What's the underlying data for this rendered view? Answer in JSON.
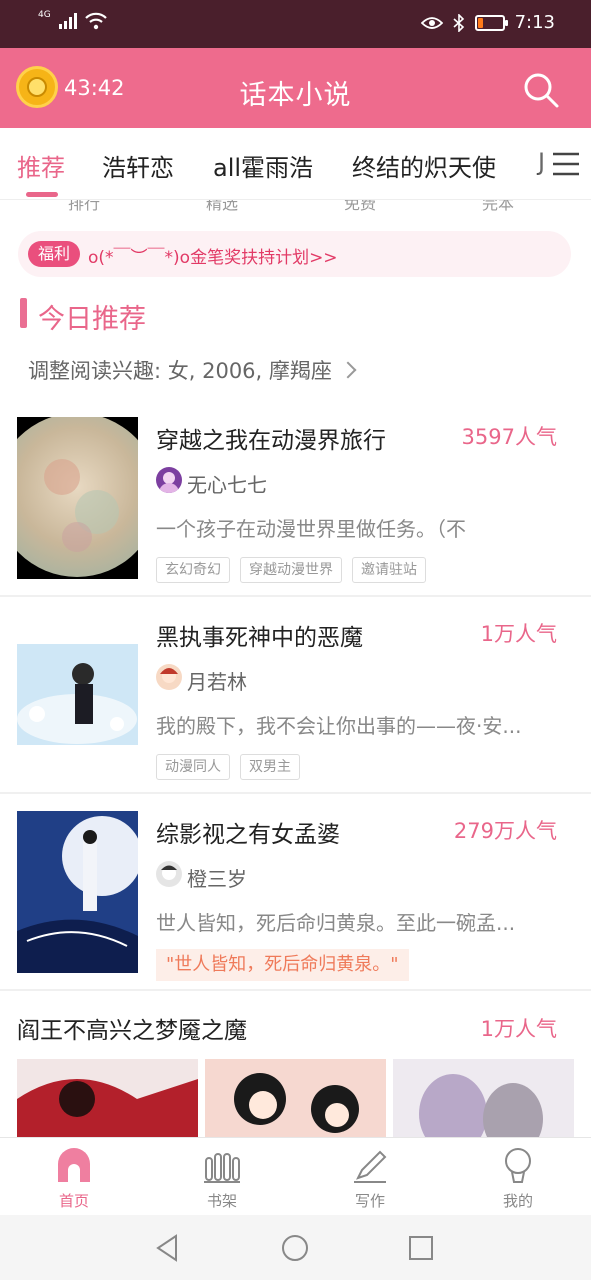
{
  "status_bar": {
    "network": "4G",
    "time": "7:13",
    "battery_level": 0.2
  },
  "header": {
    "timer": "43:42",
    "title": "话本小说"
  },
  "tabs": [
    {
      "label": "推荐",
      "active": true
    },
    {
      "label": "浩轩恋",
      "active": false
    },
    {
      "label": "all霍雨浩",
      "active": false
    },
    {
      "label": "终结的炽天使",
      "active": false
    },
    {
      "label": "J",
      "active": false
    }
  ],
  "sub_categories": [
    "排行",
    "精选",
    "免费",
    "完本"
  ],
  "benefit": {
    "tag": "福利",
    "text": "o(*￣︶￣*)o金笔奖扶持计划>>"
  },
  "section": {
    "title": "今日推荐",
    "interest": "调整阅读兴趣: 女, 2006, 摩羯座"
  },
  "books": [
    {
      "title": "穿越之我在动漫界旅行",
      "popularity": "3597人气",
      "author": "无心七七",
      "description": "一个孩子在动漫世界里做任务。（不",
      "tags": [
        "玄幻奇幻",
        "穿越动漫世界",
        "邀请驻站"
      ]
    },
    {
      "title": "黑执事死神中的恶魔",
      "popularity": "1万人气",
      "author": "月若林",
      "description": "我的殿下，我不会让你出事的——夜·安...",
      "tags": [
        "动漫同人",
        "双男主"
      ]
    },
    {
      "title": "综影视之有女孟婆",
      "popularity": "279万人气",
      "author": "橙三岁",
      "description": "世人皆知，死后命归黄泉。至此一碗孟...",
      "quote": "\"世人皆知，死后命归黄泉。\""
    }
  ],
  "featured_row": {
    "title": "阎王不高兴之梦魇之魔",
    "popularity": "1万人气"
  },
  "bottom_nav": [
    {
      "label": "首页",
      "active": true
    },
    {
      "label": "书架",
      "active": false
    },
    {
      "label": "写作",
      "active": false
    },
    {
      "label": "我的",
      "active": false
    }
  ],
  "colors": {
    "accent": "#e9668a",
    "header_bg": "#ee6b8d",
    "status_bg": "#4a1f2c"
  }
}
